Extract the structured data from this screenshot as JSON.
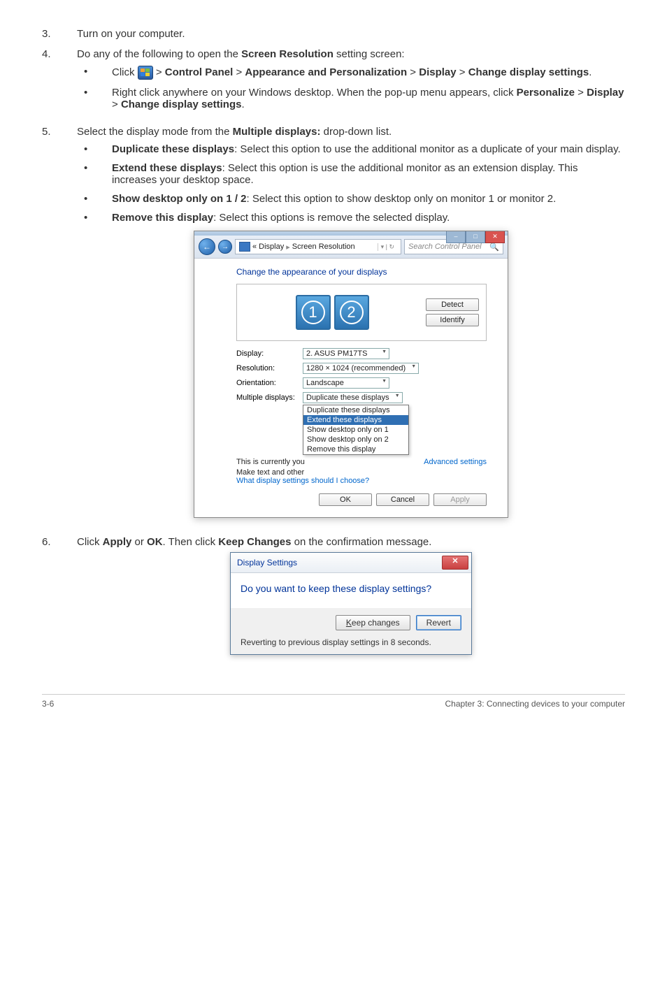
{
  "steps": {
    "s3_num": "3.",
    "s3_text": "Turn on your computer.",
    "s4_num": "4.",
    "s4_lead": "Do any of the following to open the ",
    "s4_bold": "Screen Resolution",
    "s4_tail": " setting screen:",
    "s4_b1_a": "Click ",
    "s4_b1_b": " > ",
    "s4_b1_cp": "Control Panel",
    "s4_b1_ap": "Appearance and Personalization",
    "s4_b1_disp": "Display",
    "s4_b1_cds": "Change display settings",
    "s4_b1_dot": ".",
    "s4_b2_a": "Right click anywhere on your Windows desktop. When the pop-up menu appears, click ",
    "s4_b2_p": "Personalize",
    "s4_b2_d": "Display",
    "s4_b2_c": "Change display settings",
    "s5_num": "5.",
    "s5_lead": "Select the display mode from the ",
    "s5_bold": "Multiple displays:",
    "s5_tail": " drop-down list.",
    "s5_b1_t": "Duplicate these displays",
    "s5_b1_x": ": Select this option to use the additional monitor as a duplicate of your main display.",
    "s5_b2_t": "Extend these displays",
    "s5_b2_x": ": Select this option is use the additional monitor as an extension display. This increases your desktop space.",
    "s5_b3_t": "Show desktop only on 1 / 2",
    "s5_b3_x": ": Select this option to show desktop only on monitor 1 or monitor 2.",
    "s5_b4_t": "Remove this display",
    "s5_b4_x": ": Select this options is remove the selected display.",
    "s6_num": "6.",
    "s6_a": "Click ",
    "s6_apply": "Apply",
    "s6_or": " or ",
    "s6_ok": "OK",
    "s6_b": ". Then click ",
    "s6_kc": "Keep Changes",
    "s6_c": " on the confirmation message."
  },
  "sr": {
    "path_seg1": "«  Display",
    "path_seg2": "Screen Resolution",
    "search_placeholder": "Search Control Panel",
    "heading": "Change the appearance of your displays",
    "mon1": "1",
    "mon2": "2",
    "btn_detect": "Detect",
    "btn_identify": "Identify",
    "lbl_display": "Display:",
    "val_display": "2. ASUS PM17TS",
    "lbl_resolution": "Resolution:",
    "val_resolution": "1280 × 1024 (recommended)",
    "lbl_orientation": "Orientation:",
    "val_orientation": "Landscape",
    "lbl_multiple": "Multiple displays:",
    "val_multiple": "Duplicate these displays",
    "dd_opt1": "Duplicate these displays",
    "dd_opt2": "Extend these displays",
    "dd_opt3": "Show desktop only on 1",
    "dd_opt4": "Show desktop only on 2",
    "dd_opt5": "Remove this display",
    "txt_currently": "This is currently you",
    "link_adv": "Advanced settings",
    "txt_maketext": "Make text and other",
    "link_what": "What display settings should I choose?",
    "btn_ok": "OK",
    "btn_cancel": "Cancel",
    "btn_apply": "Apply"
  },
  "ds": {
    "title": "Display Settings",
    "question": "Do you want to keep these display settings?",
    "btn_keep": "Keep changes",
    "btn_revert": "Revert",
    "footer": "Reverting to previous display settings in 8 seconds."
  },
  "footer": {
    "left": "3-6",
    "right": "Chapter 3: Connecting devices to your computer"
  }
}
